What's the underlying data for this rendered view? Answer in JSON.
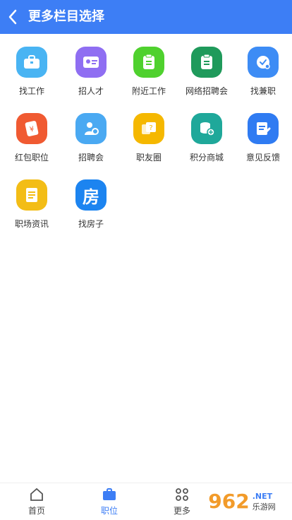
{
  "header": {
    "title": "更多栏目选择"
  },
  "items": [
    {
      "label": "找工作",
      "color": "#49b4f3",
      "icon": "briefcase-icon"
    },
    {
      "label": "招人才",
      "color": "#8f6ef2",
      "icon": "id-card-icon"
    },
    {
      "label": "附近工作",
      "color": "#4fd12e",
      "icon": "clipboard-icon"
    },
    {
      "label": "网络招聘会",
      "color": "#1f9a5b",
      "icon": "clipboard-icon"
    },
    {
      "label": "找兼职",
      "color": "#3d8cf5",
      "icon": "clock-icon"
    },
    {
      "label": "红包职位",
      "color": "#f05a32",
      "icon": "red-envelope-icon"
    },
    {
      "label": "招聘会",
      "color": "#4aa9f2",
      "icon": "person-icon"
    },
    {
      "label": "职友圈",
      "color": "#f5b800",
      "icon": "question-chat-icon"
    },
    {
      "label": "积分商城",
      "color": "#1fa89a",
      "icon": "coins-icon"
    },
    {
      "label": "意见反馈",
      "color": "#2f7bf2",
      "icon": "document-edit-icon"
    },
    {
      "label": "职场资讯",
      "color": "#f3bd16",
      "icon": "news-icon"
    },
    {
      "label": "找房子",
      "color": "#1c84f0",
      "icon": "house-icon",
      "glyph": "房"
    }
  ],
  "tabbar": {
    "tabs": [
      {
        "label": "首页",
        "icon": "home-icon"
      },
      {
        "label": "职位",
        "icon": "briefcase-icon",
        "active": true
      },
      {
        "label": "更多",
        "icon": "grid-icon"
      }
    ]
  },
  "watermark": {
    "big": "962",
    "small_net": ".NET",
    "small_text": "乐游网"
  }
}
